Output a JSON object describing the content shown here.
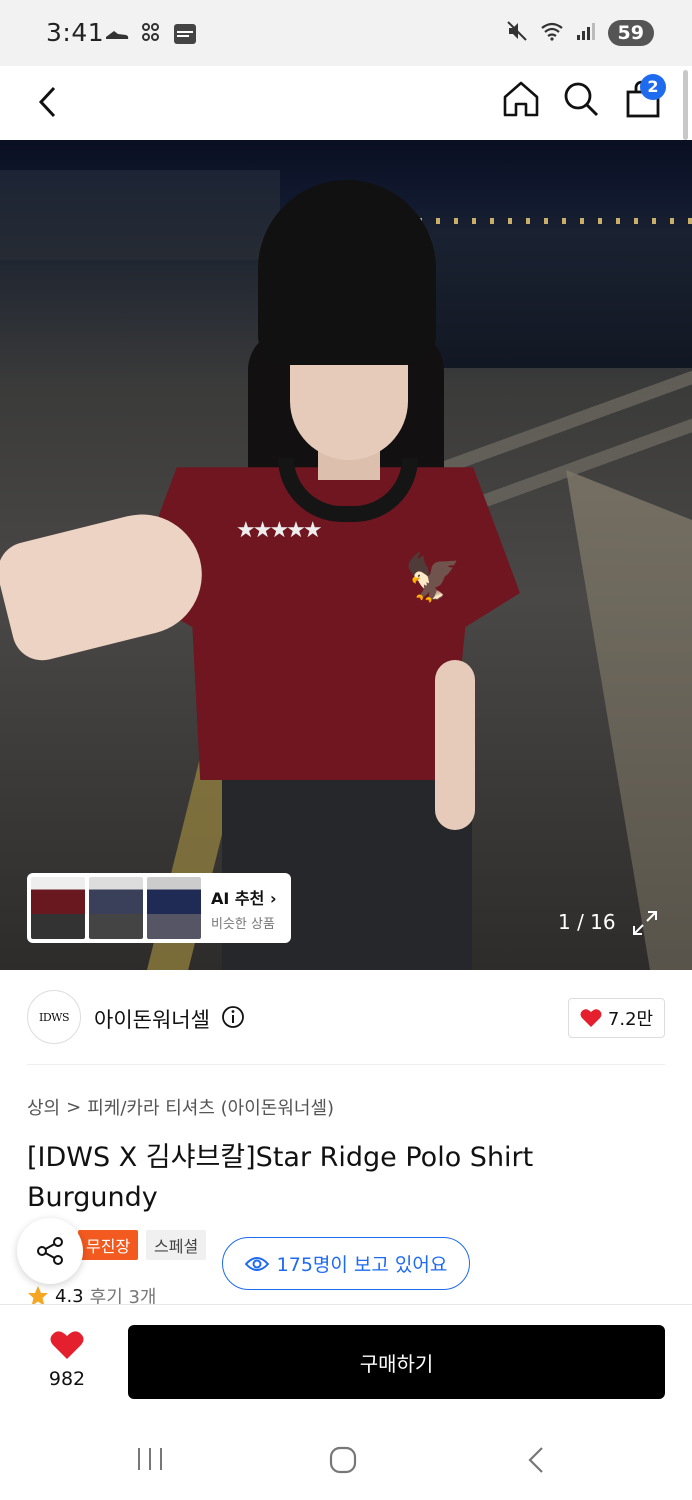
{
  "status": {
    "time": "3:41",
    "battery": "59"
  },
  "header": {
    "cart_count": "2"
  },
  "hero": {
    "counter": "1 / 16",
    "ai": {
      "title": "AI 추천",
      "chevron": "›",
      "subtitle": "비슷한 상품"
    }
  },
  "brand": {
    "logo_text": "IDWS",
    "name": "아이돈워너셀",
    "likes": "7.2만"
  },
  "breadcrumb": {
    "level1": "상의",
    "separator": ">",
    "level2": "피케/카라 티셔츠 (아이돈워너셀)"
  },
  "product": {
    "title": "[IDWS X 김샤브칼]Star Ridge Polo Shirt Burgundy",
    "badges": [
      "무진장",
      "스페셜"
    ],
    "viewers": "175명이 보고 있어요",
    "rating": "4.3",
    "reviews": "후기 3개"
  },
  "bottom": {
    "fav_count": "982",
    "buy_label": "구매하기"
  },
  "colors": {
    "accent_blue": "#1e6bf0",
    "badge_orange": "#f25a1f",
    "heart_red": "#e5202e",
    "buy_black": "#000000"
  }
}
